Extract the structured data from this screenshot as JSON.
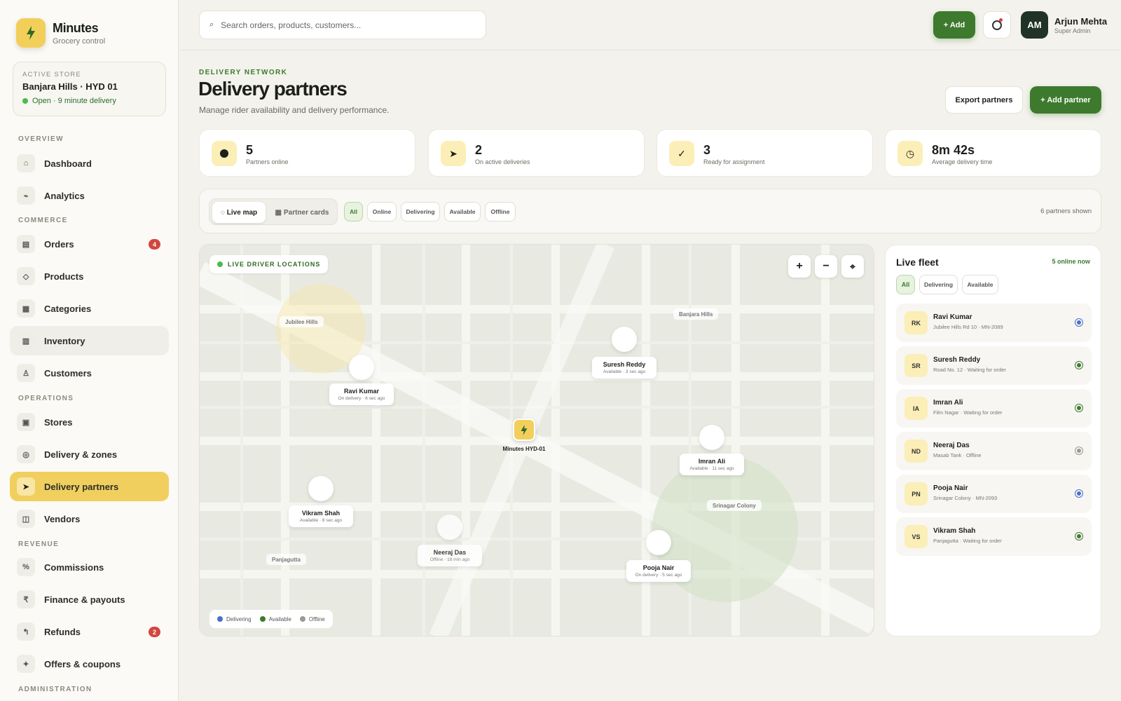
{
  "brand": {
    "name": "Minutes",
    "subtitle": "Grocery control"
  },
  "store": {
    "label": "ACTIVE STORE",
    "name": "Banjara Hills · HYD 01",
    "status": "Open · 9 minute delivery"
  },
  "nav": {
    "sections": [
      "OVERVIEW",
      "COMMERCE",
      "OPERATIONS",
      "REVENUE",
      "ADMINISTRATION"
    ],
    "items": [
      {
        "label": "Dashboard",
        "icon": "home-icon"
      },
      {
        "label": "Analytics",
        "icon": "chart-icon"
      },
      {
        "label": "Orders",
        "icon": "orders-icon",
        "badge": "4"
      },
      {
        "label": "Products",
        "icon": "diamond-icon"
      },
      {
        "label": "Categories",
        "icon": "grid-icon"
      },
      {
        "label": "Inventory",
        "icon": "inventory-icon"
      },
      {
        "label": "Customers",
        "icon": "person-icon"
      },
      {
        "label": "Stores",
        "icon": "store-icon"
      },
      {
        "label": "Delivery & zones",
        "icon": "zone-icon"
      },
      {
        "label": "Delivery partners",
        "icon": "arrow-icon"
      },
      {
        "label": "Vendors",
        "icon": "vendor-icon"
      },
      {
        "label": "Commissions",
        "icon": "percent-icon"
      },
      {
        "label": "Finance & payouts",
        "icon": "rupee-icon"
      },
      {
        "label": "Refunds",
        "icon": "refund-icon",
        "badge": "2"
      },
      {
        "label": "Offers & coupons",
        "icon": "sparkle-icon"
      }
    ]
  },
  "topbar": {
    "search_placeholder": "Search orders, products, customers...",
    "add_label": "+ Add",
    "user_initials": "AM",
    "user_name": "Arjun Mehta",
    "user_role": "Super Admin"
  },
  "page": {
    "eyebrow": "DELIVERY NETWORK",
    "title": "Delivery partners",
    "subtitle": "Manage rider availability and delivery performance.",
    "export_label": "Export partners",
    "add_partner_label": "+ Add partner"
  },
  "stats": [
    {
      "value": "5",
      "label": "Partners online",
      "icon": "dot-icon"
    },
    {
      "value": "2",
      "label": "On active deliveries",
      "icon": "send-icon"
    },
    {
      "value": "3",
      "label": "Ready for assignment",
      "icon": "check-icon"
    },
    {
      "value": "8m 42s",
      "label": "Average delivery time",
      "icon": "clock-icon"
    }
  ],
  "filters": {
    "view_map": "Live map",
    "view_cards": "Partner cards",
    "chips": [
      "All",
      "Online",
      "Delivering",
      "Available",
      "Offline"
    ],
    "shown": "6 partners shown"
  },
  "map": {
    "live_label": "LIVE DRIVER LOCATIONS",
    "areas": [
      "Jubilee Hills",
      "Banjara Hills",
      "Srinagar Colony",
      "Panjagutta"
    ],
    "hub_label": "Minutes HYD-01",
    "markers": [
      {
        "name": "Ravi Kumar",
        "status": "On delivery · 6 sec ago"
      },
      {
        "name": "Suresh Reddy",
        "status": "Available · 3 sec ago"
      },
      {
        "name": "Imran Ali",
        "status": "Available · 11 sec ago"
      },
      {
        "name": "Vikram Shah",
        "status": "Available · 8 sec ago"
      },
      {
        "name": "Neeraj Das",
        "status": "Offline · 18 min ago"
      },
      {
        "name": "Pooja Nair",
        "status": "On delivery · 5 sec ago"
      }
    ],
    "legend": [
      "Delivering",
      "Available",
      "Offline"
    ]
  },
  "colors": {
    "delivering": "#4a6fc9",
    "available": "#3d7a2e",
    "offline": "#9a9a94",
    "accent": "#f2cf5b",
    "green": "#3d7a2e"
  },
  "fleet": {
    "title": "Live fleet",
    "online": "5 online now",
    "chips": [
      "All",
      "Delivering",
      "Available"
    ],
    "rows": [
      {
        "initials": "RK",
        "name": "Ravi Kumar",
        "sub": "Jubilee Hills Rd 10 · MN-2089",
        "status": "delivering"
      },
      {
        "initials": "SR",
        "name": "Suresh Reddy",
        "sub": "Road No. 12 · Waiting for order",
        "status": "available"
      },
      {
        "initials": "IA",
        "name": "Imran Ali",
        "sub": "Film Nagar · Waiting for order",
        "status": "available"
      },
      {
        "initials": "ND",
        "name": "Neeraj Das",
        "sub": "Masab Tank · Offline",
        "status": "offline"
      },
      {
        "initials": "PN",
        "name": "Pooja Nair",
        "sub": "Srinagar Colony · MN-2093",
        "status": "delivering"
      },
      {
        "initials": "VS",
        "name": "Vikram Shah",
        "sub": "Panjagutta · Waiting for order",
        "status": "available"
      }
    ]
  }
}
